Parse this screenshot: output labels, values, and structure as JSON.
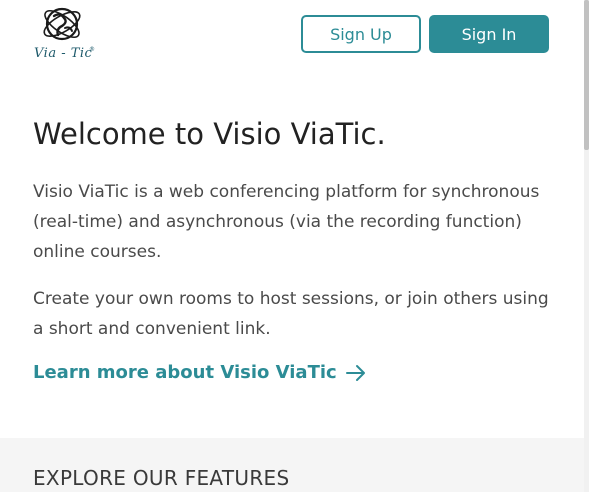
{
  "header": {
    "logo_text": "Via - Tic",
    "logo_reg": "®",
    "signup_label": "Sign Up",
    "signin_label": "Sign In"
  },
  "hero": {
    "title": "Welcome to Visio ViaTic.",
    "paragraph1": "Visio ViaTic is a web conferencing platform for synchronous (real-time) and asynchronous (via the recording function) online courses.",
    "paragraph2": "Create your own rooms to host sessions, or join others using a short and convenient link.",
    "learn_more_label": "Learn more about Visio ViaTic"
  },
  "features": {
    "title": "EXPLORE OUR FEATURES"
  },
  "colors": {
    "accent": "#2c8c96",
    "logo": "#1e5a6b",
    "band": "#f5f5f5"
  },
  "icons": {
    "logo": "globe-emblem-icon",
    "learn_more": "arrow-right-icon"
  }
}
